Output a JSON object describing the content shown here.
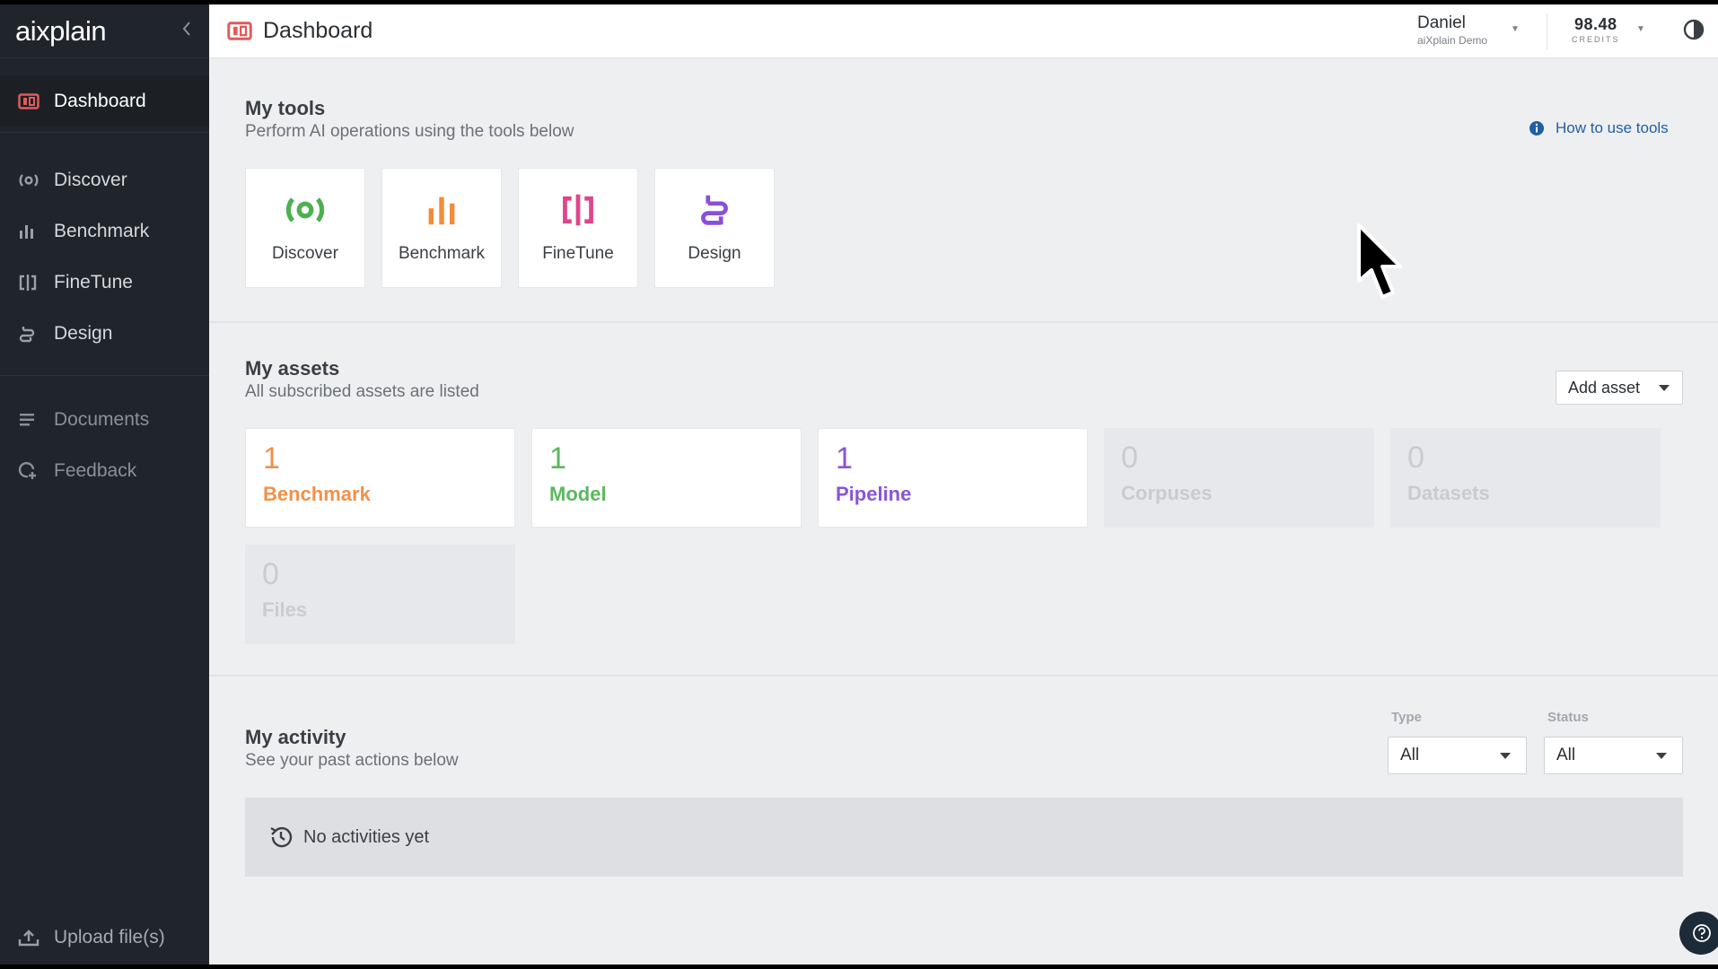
{
  "sidebar": {
    "logo": "aixplain",
    "collapse_icon": "chevron-left-icon",
    "items": [
      {
        "label": "Dashboard",
        "icon": "dashboard-icon",
        "active": true
      },
      {
        "label": "Discover",
        "icon": "discover-icon"
      },
      {
        "label": "Benchmark",
        "icon": "bar-chart-icon"
      },
      {
        "label": "FineTune",
        "icon": "finetune-icon"
      },
      {
        "label": "Design",
        "icon": "design-icon"
      },
      {
        "label": "Documents",
        "icon": "document-icon"
      },
      {
        "label": "Feedback",
        "icon": "feedback-icon"
      }
    ],
    "upload_label": "Upload file(s)"
  },
  "header": {
    "title": "Dashboard",
    "user_name": "Daniel",
    "user_org": "aiXplain Demo",
    "credits_value": "98.48",
    "credits_label": "CREDITS"
  },
  "tools": {
    "title": "My tools",
    "subtitle": "Perform AI operations using the tools below",
    "help_link": "How to use tools",
    "cards": [
      {
        "label": "Discover",
        "color": "#4cb050"
      },
      {
        "label": "Benchmark",
        "color": "#f28c3a"
      },
      {
        "label": "FineTune",
        "color": "#e0458b"
      },
      {
        "label": "Design",
        "color": "#8a4fd8"
      }
    ]
  },
  "assets": {
    "title": "My assets",
    "subtitle": "All subscribed assets are listed",
    "add_label": "Add asset",
    "items": [
      {
        "count": "1",
        "name": "Benchmark",
        "color": "#f0914a"
      },
      {
        "count": "1",
        "name": "Model",
        "color": "#5bb85f"
      },
      {
        "count": "1",
        "name": "Pipeline",
        "color": "#8a55d6"
      },
      {
        "count": "0",
        "name": "Corpuses"
      },
      {
        "count": "0",
        "name": "Datasets"
      },
      {
        "count": "0",
        "name": "Files"
      }
    ]
  },
  "activity": {
    "title": "My activity",
    "subtitle": "See your past actions below",
    "type_label": "Type",
    "type_value": "All",
    "status_label": "Status",
    "status_value": "All",
    "empty_text": "No activities yet"
  }
}
